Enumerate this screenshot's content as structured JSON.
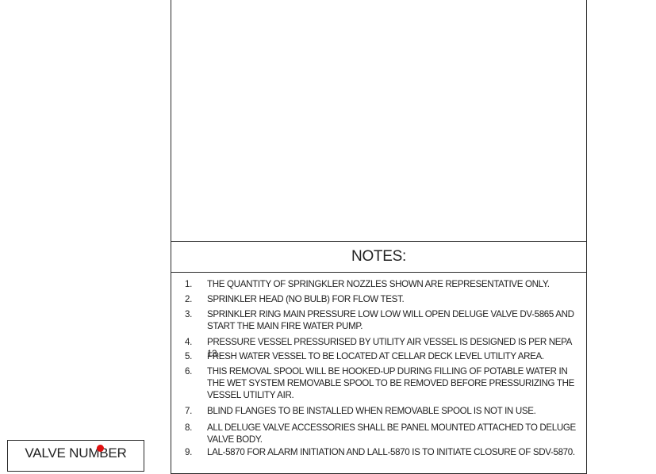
{
  "notes": {
    "title": "NOTES:",
    "items": [
      {
        "num": "1.",
        "text": "THE QUANTITY OF SPRINGKLER NOZZLES SHOWN ARE REPRESENTATIVE ONLY."
      },
      {
        "num": "2.",
        "text": "SPRINKLER HEAD (NO BULB) FOR FLOW TEST."
      },
      {
        "num": "3.",
        "text": "SPRINKLER RING MAIN PRESSURE LOW LOW WILL OPEN DELUGE VALVE DV-5865 AND\nSTART THE MAIN FIRE WATER PUMP."
      },
      {
        "num": "4.",
        "text": "PRESSURE VESSEL PRESSURISED BY UTILITY AIR VESSEL IS DESIGNED IS PER NEPA 13."
      },
      {
        "num": "5.",
        "text": "FRESH WATER VESSEL TO BE LOCATED AT CELLAR DECK LEVEL UTILITY AREA."
      },
      {
        "num": "6.",
        "text": "THIS REMOVAL SPOOL WILL BE HOOKED-UP DURING FILLING OF POTABLE WATER IN\nTHE WET SYSTEM REMOVABLE SPOOL TO BE REMOVED BEFORE PRESSURIZING THE\nVESSEL UTILITY AIR."
      },
      {
        "num": "7.",
        "text": "BLIND FLANGES TO BE INSTALLED WHEN REMOVABLE SPOOL IS NOT IN USE."
      },
      {
        "num": "8.",
        "text": "ALL DELUGE VALVE ACCESSORIES SHALL BE PANEL MOUNTED ATTACHED TO DELUGE\nVALVE BODY."
      },
      {
        "num": "9.",
        "text": "LAL-5870 FOR ALARM INITIATION AND LALL-5870 IS TO INITIATE CLOSURE OF SDV-5870."
      }
    ]
  },
  "valve_box": {
    "label": "VALVE NUMBER"
  },
  "colors": {
    "line": "#2a2a2a",
    "marker": "#e01010"
  }
}
